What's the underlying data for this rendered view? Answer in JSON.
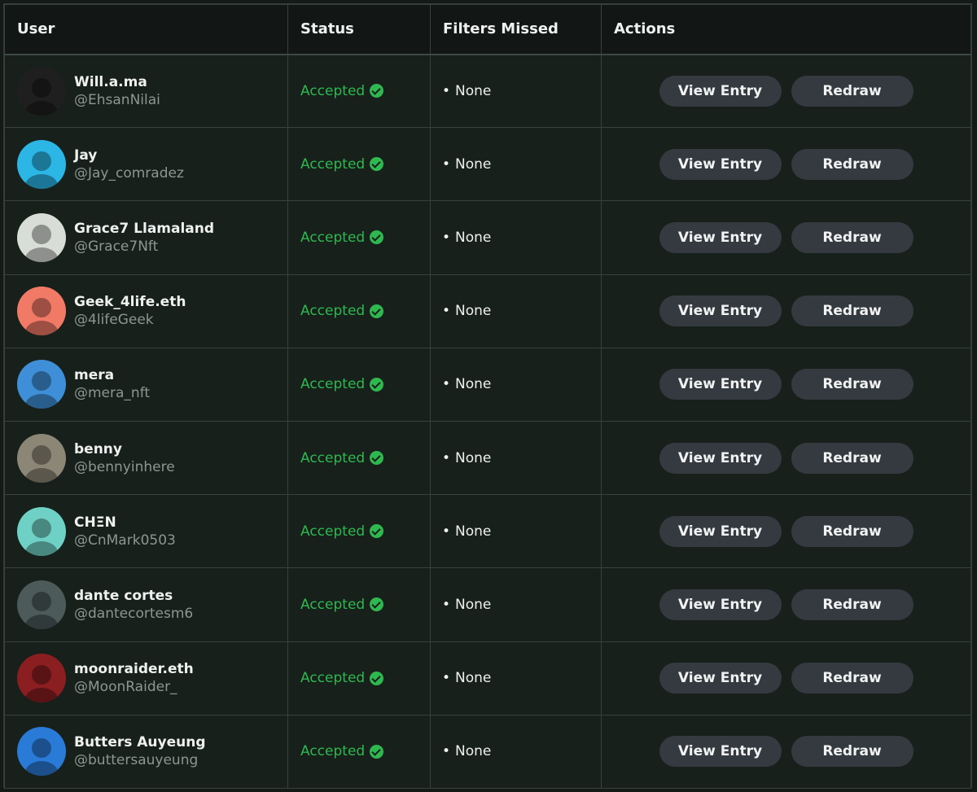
{
  "headers": {
    "user": "User",
    "status": "Status",
    "filters": "Filters Missed",
    "actions": "Actions"
  },
  "rows": [
    {
      "name": "Will.a.ma",
      "handle": "@EhsanNilai",
      "status": "Accepted",
      "filters": "None",
      "avatar_color": "#1f1f1f"
    },
    {
      "name": "Jay",
      "handle": "@Jay_comradez",
      "status": "Accepted",
      "filters": "None",
      "avatar_color": "#2bb6e6"
    },
    {
      "name": "Grace7 Llamaland",
      "handle": "@Grace7Nft",
      "status": "Accepted",
      "filters": "None",
      "avatar_color": "#d9ddd8"
    },
    {
      "name": "Geek_4life.eth",
      "handle": "@4lifeGeek",
      "status": "Accepted",
      "filters": "None",
      "avatar_color": "#f07a66"
    },
    {
      "name": "mera",
      "handle": "@mera_nft",
      "status": "Accepted",
      "filters": "None",
      "avatar_color": "#3f8fd8"
    },
    {
      "name": "benny",
      "handle": "@bennyinhere",
      "status": "Accepted",
      "filters": "None",
      "avatar_color": "#8c8677"
    },
    {
      "name": "CHΞN",
      "handle": "@CnMark0503",
      "status": "Accepted",
      "filters": "None",
      "avatar_color": "#6fd1c5"
    },
    {
      "name": "dante cortes",
      "handle": "@dantecortesm6",
      "status": "Accepted",
      "filters": "None",
      "avatar_color": "#4c5a5a"
    },
    {
      "name": "moonraider.eth",
      "handle": "@MoonRaider_",
      "status": "Accepted",
      "filters": "None",
      "avatar_color": "#8a1e20"
    },
    {
      "name": "Butters Auyeung",
      "handle": "@buttersauyeung",
      "status": "Accepted",
      "filters": "None",
      "avatar_color": "#2a7bd8"
    }
  ],
  "buttons": {
    "view_label": "View Entry",
    "redraw_label": "Redraw"
  },
  "colors": {
    "accepted": "#2fb84f",
    "button_bg": "#343a40",
    "background": "#17201b"
  }
}
